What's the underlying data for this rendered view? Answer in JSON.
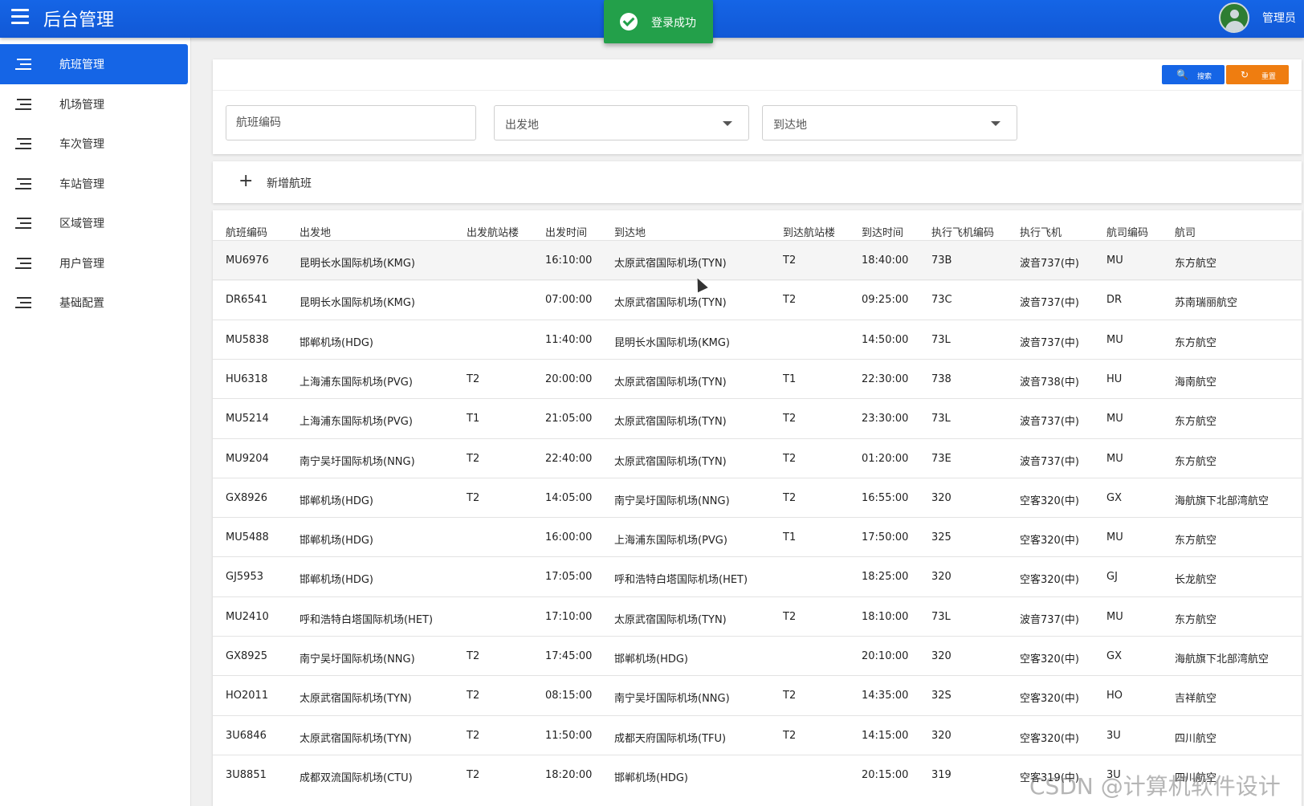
{
  "app": {
    "title": "后台管理",
    "user": "管理员"
  },
  "toast": {
    "message": "登录成功"
  },
  "sidebar": {
    "items": [
      {
        "label": "航班管理",
        "active": true
      },
      {
        "label": "机场管理"
      },
      {
        "label": "车次管理"
      },
      {
        "label": "车站管理"
      },
      {
        "label": "区域管理"
      },
      {
        "label": "用户管理"
      },
      {
        "label": "基础配置"
      }
    ]
  },
  "search": {
    "search_label": "搜索",
    "reset_label": "重置",
    "code_placeholder": "航班编码",
    "departure_placeholder": "出发地",
    "arrival_placeholder": "到达地"
  },
  "actions": {
    "add_label": "新增航班"
  },
  "table": {
    "headers": [
      "航班编码",
      "出发地",
      "出发航站楼",
      "出发时间",
      "到达地",
      "到达航站楼",
      "到达时间",
      "执行飞机编码",
      "执行飞机",
      "航司编码",
      "航司"
    ],
    "rows": [
      [
        "MU6976",
        "昆明长水国际机场(KMG)",
        "",
        "16:10:00",
        "太原武宿国际机场(TYN)",
        "T2",
        "18:40:00",
        "73B",
        "波音737(中)",
        "MU",
        "东方航空"
      ],
      [
        "DR6541",
        "昆明长水国际机场(KMG)",
        "",
        "07:00:00",
        "太原武宿国际机场(TYN)",
        "T2",
        "09:25:00",
        "73C",
        "波音737(中)",
        "DR",
        "苏南瑞丽航空"
      ],
      [
        "MU5838",
        "邯郸机场(HDG)",
        "",
        "11:40:00",
        "昆明长水国际机场(KMG)",
        "",
        "14:50:00",
        "73L",
        "波音737(中)",
        "MU",
        "东方航空"
      ],
      [
        "HU6318",
        "上海浦东国际机场(PVG)",
        "T2",
        "20:00:00",
        "太原武宿国际机场(TYN)",
        "T1",
        "22:30:00",
        "738",
        "波音738(中)",
        "HU",
        "海南航空"
      ],
      [
        "MU5214",
        "上海浦东国际机场(PVG)",
        "T1",
        "21:05:00",
        "太原武宿国际机场(TYN)",
        "T2",
        "23:30:00",
        "73L",
        "波音737(中)",
        "MU",
        "东方航空"
      ],
      [
        "MU9204",
        "南宁吴圩国际机场(NNG)",
        "T2",
        "22:40:00",
        "太原武宿国际机场(TYN)",
        "T2",
        "01:20:00",
        "73E",
        "波音737(中)",
        "MU",
        "东方航空"
      ],
      [
        "GX8926",
        "邯郸机场(HDG)",
        "T2",
        "14:05:00",
        "南宁吴圩国际机场(NNG)",
        "T2",
        "16:55:00",
        "320",
        "空客320(中)",
        "GX",
        "海航旗下北部湾航空"
      ],
      [
        "MU5488",
        "邯郸机场(HDG)",
        "",
        "16:00:00",
        "上海浦东国际机场(PVG)",
        "T1",
        "17:50:00",
        "325",
        "空客320(中)",
        "MU",
        "东方航空"
      ],
      [
        "GJ5953",
        "邯郸机场(HDG)",
        "",
        "17:05:00",
        "呼和浩特白塔国际机场(HET)",
        "",
        "18:25:00",
        "320",
        "空客320(中)",
        "GJ",
        "长龙航空"
      ],
      [
        "MU2410",
        "呼和浩特白塔国际机场(HET)",
        "",
        "17:10:00",
        "太原武宿国际机场(TYN)",
        "T2",
        "18:10:00",
        "73L",
        "波音737(中)",
        "MU",
        "东方航空"
      ],
      [
        "GX8925",
        "南宁吴圩国际机场(NNG)",
        "T2",
        "17:45:00",
        "邯郸机场(HDG)",
        "",
        "20:10:00",
        "320",
        "空客320(中)",
        "GX",
        "海航旗下北部湾航空"
      ],
      [
        "HO2011",
        "太原武宿国际机场(TYN)",
        "T2",
        "08:15:00",
        "南宁吴圩国际机场(NNG)",
        "T2",
        "14:35:00",
        "32S",
        "空客320(中)",
        "HO",
        "吉祥航空"
      ],
      [
        "3U6846",
        "太原武宿国际机场(TYN)",
        "T2",
        "11:50:00",
        "成都天府国际机场(TFU)",
        "T2",
        "14:15:00",
        "320",
        "空客320(中)",
        "3U",
        "四川航空"
      ],
      [
        "3U8851",
        "成都双流国际机场(CTU)",
        "T2",
        "18:20:00",
        "邯郸机场(HDG)",
        "",
        "20:15:00",
        "319",
        "空客319(中)",
        "3U",
        "四川航空"
      ]
    ]
  },
  "watermark": "CSDN @计算机软件设计"
}
